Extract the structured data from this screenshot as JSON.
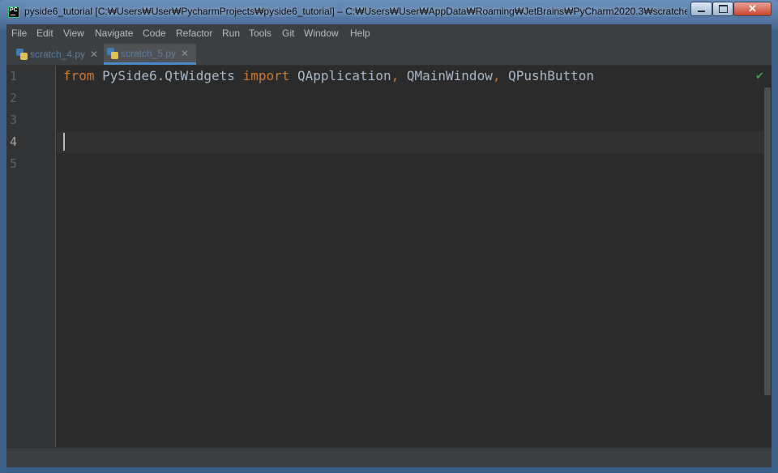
{
  "window": {
    "title": "pyside6_tutorial [C:₩Users₩User₩PycharmProjects₩pyside6_tutorial] – C:₩Users₩User₩AppData₩Roaming₩JetBrains₩PyCharm2020.3₩scratches₩scr...",
    "close_glyph": "✕"
  },
  "menu": {
    "items": [
      {
        "label": "File"
      },
      {
        "label": "Edit"
      },
      {
        "label": "View"
      },
      {
        "label": "Navigate"
      },
      {
        "label": "Code"
      },
      {
        "label": "Refactor"
      },
      {
        "label": "Run"
      },
      {
        "label": "Tools"
      },
      {
        "label": "Git"
      },
      {
        "label": "Window"
      },
      {
        "label": "Help"
      }
    ]
  },
  "tabs": [
    {
      "label": "scratch_4.py",
      "active": false,
      "close_glyph": "✕"
    },
    {
      "label": "scratch_5.py",
      "active": true,
      "close_glyph": "✕"
    }
  ],
  "editor": {
    "line_numbers": [
      "1",
      "2",
      "3",
      "4",
      "5"
    ],
    "current_line": 4,
    "code_line_1": {
      "kw_from": "from",
      "module": " PySide6.QtWidgets ",
      "kw_import": "import",
      "name_1": " QApplication",
      "comma_1": ",",
      "name_2": " QMainWindow",
      "comma_2": ",",
      "name_3": " QPushButton"
    },
    "inspection_glyph": "✔"
  },
  "colors": {
    "editor_bg": "#2b2b2b",
    "keyword": "#cc7832",
    "text": "#a9b7c6",
    "tab_accent": "#4a88c7"
  }
}
